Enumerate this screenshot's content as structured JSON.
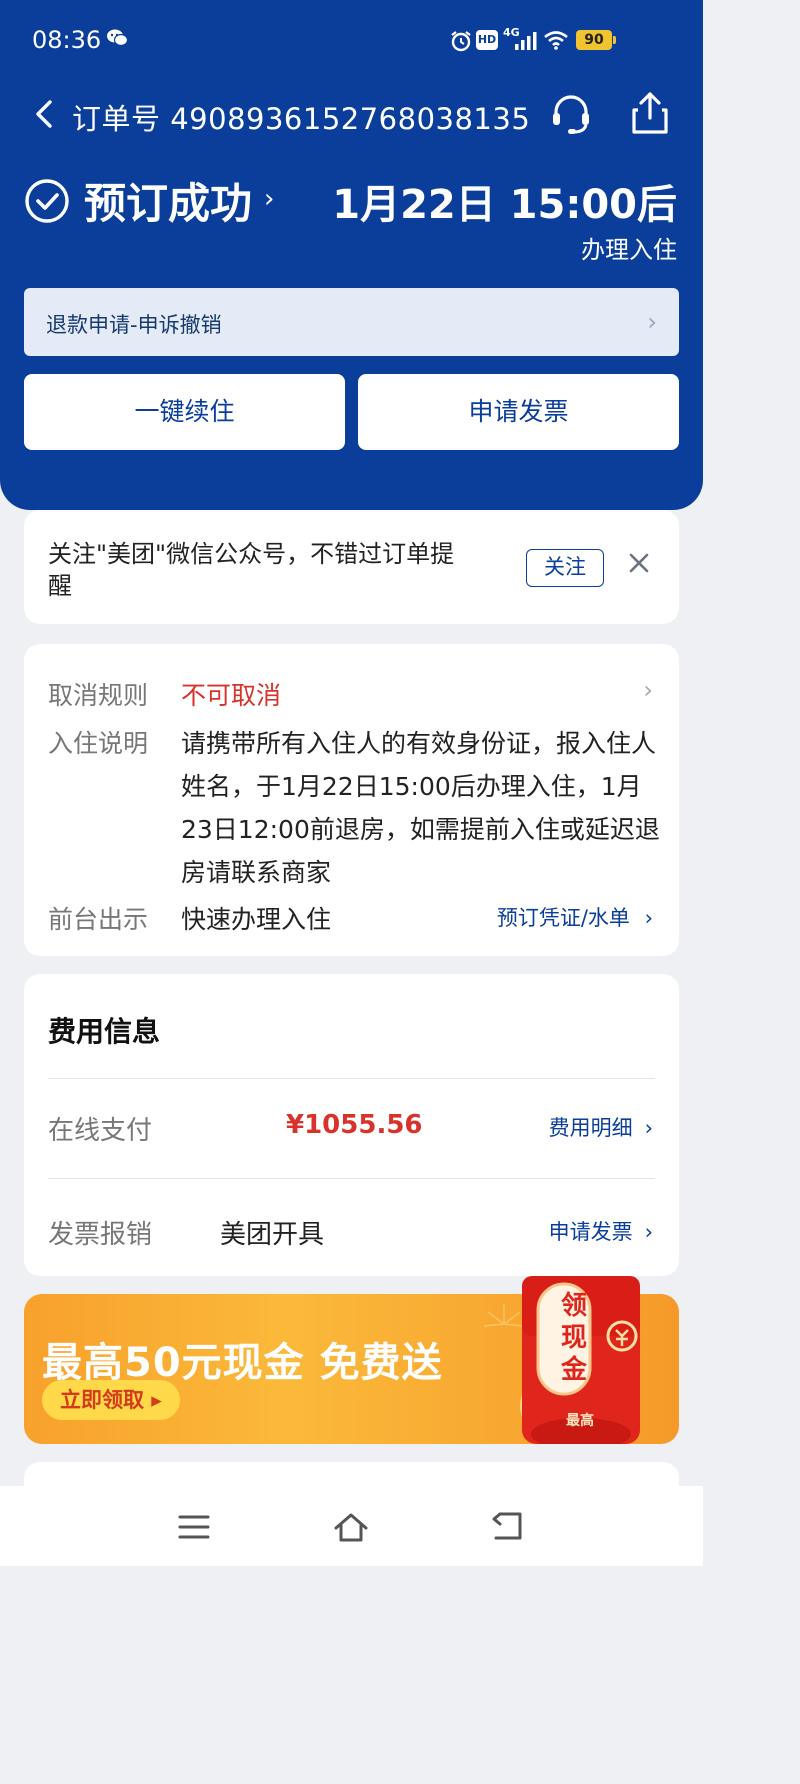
{
  "status_bar": {
    "time": "08:36",
    "battery": "90",
    "network": "4G"
  },
  "header": {
    "order_number": "订单号 4908936152768038135",
    "status": "预订成功",
    "checkin_time": "1月22日 15:00后",
    "checkin_label": "办理入住"
  },
  "refund_bar": {
    "label": "退款申请-申诉撤销"
  },
  "actions": {
    "renew": "一键续住",
    "invoice": "申请发票"
  },
  "follow_card": {
    "text": "关注\"美团\"微信公众号，不错过订单提醒",
    "button": "关注"
  },
  "rules": {
    "cancel_label": "取消规则",
    "cancel_value": "不可取消",
    "checkin_label": "入住说明",
    "checkin_value": "请携带所有入住人的有效身份证，报入住人姓名，于1月22日15:00后办理入住，1月23日12:00前退房，如需提前入住或延迟退房请联系商家",
    "desk_label": "前台出示",
    "desk_value": "快速办理入住",
    "desk_link": "预订凭证/水单"
  },
  "fee": {
    "title": "费用信息",
    "online_label": "在线支付",
    "online_amount": "¥1055.56",
    "online_link": "费用明细",
    "invoice_label": "发票报销",
    "invoice_issuer": "美团开具",
    "invoice_link": "申请发票"
  },
  "promo": {
    "title": "最高50元现金 免费送",
    "button": "立即领取 ▸",
    "packet_text": "领现金",
    "packet_sub": "最高"
  },
  "colors": {
    "brand_blue": "#0a3e9a",
    "price_red": "#d8322b",
    "promo_orange": "#f7a12c"
  }
}
